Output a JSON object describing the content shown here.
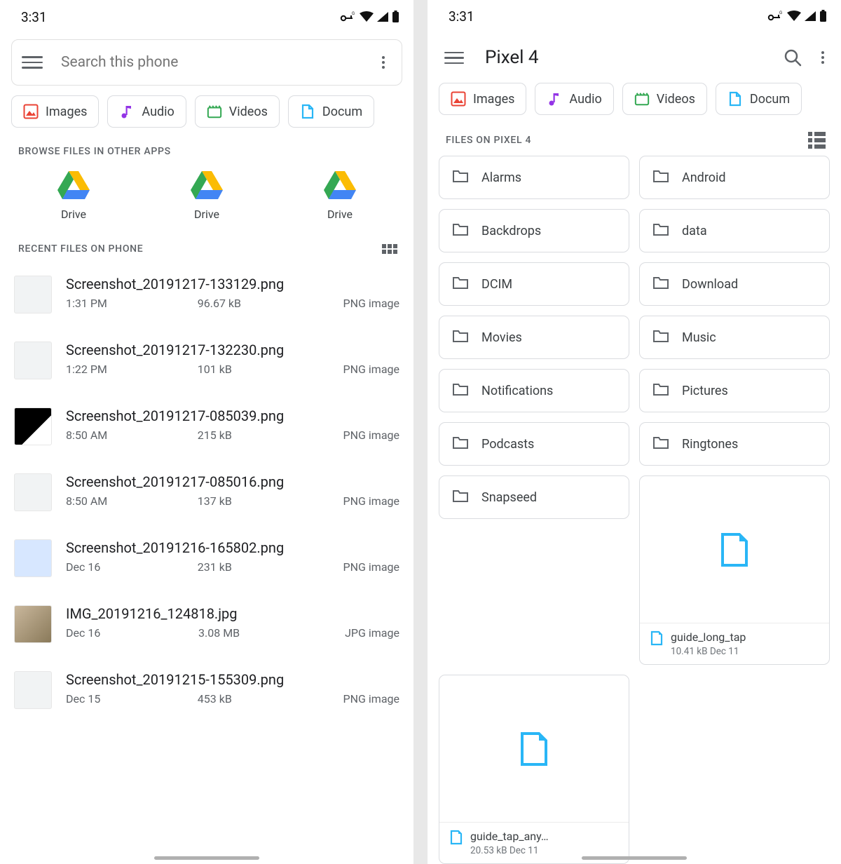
{
  "status_time": "3:31",
  "search_placeholder": "Search this phone",
  "chips": [
    {
      "label": "Images"
    },
    {
      "label": "Audio"
    },
    {
      "label": "Videos"
    },
    {
      "label": "Docum"
    }
  ],
  "left": {
    "section_browse": "BROWSE FILES IN OTHER APPS",
    "drive_label": "Drive",
    "section_recent": "RECENT FILES ON PHONE",
    "files": [
      {
        "name": "Screenshot_20191217-133129.png",
        "time": "1:31 PM",
        "size": "96.67 kB",
        "kind": "PNG image"
      },
      {
        "name": "Screenshot_20191217-132230.png",
        "time": "1:22 PM",
        "size": "101 kB",
        "kind": "PNG image"
      },
      {
        "name": "Screenshot_20191217-085039.png",
        "time": "8:50 AM",
        "size": "215 kB",
        "kind": "PNG image"
      },
      {
        "name": "Screenshot_20191217-085016.png",
        "time": "8:50 AM",
        "size": "137 kB",
        "kind": "PNG image"
      },
      {
        "name": "Screenshot_20191216-165802.png",
        "time": "Dec 16",
        "size": "231 kB",
        "kind": "PNG image"
      },
      {
        "name": "IMG_20191216_124818.jpg",
        "time": "Dec 16",
        "size": "3.08 MB",
        "kind": "JPG image"
      },
      {
        "name": "Screenshot_20191215-155309.png",
        "time": "Dec 15",
        "size": "453 kB",
        "kind": "PNG image"
      }
    ]
  },
  "right": {
    "title": "Pixel 4",
    "section_files": "FILES ON PIXEL 4",
    "folders": [
      "Alarms",
      "Android",
      "Backdrops",
      "data",
      "DCIM",
      "Download",
      "Movies",
      "Music",
      "Notifications",
      "Pictures",
      "Podcasts",
      "Ringtones",
      "Snapseed"
    ],
    "filecards": [
      {
        "name": "guide_long_tap",
        "sub": "10.41 kB Dec 11"
      },
      {
        "name": "guide_tap_any…",
        "sub": "20.53 kB Dec 11"
      }
    ]
  }
}
